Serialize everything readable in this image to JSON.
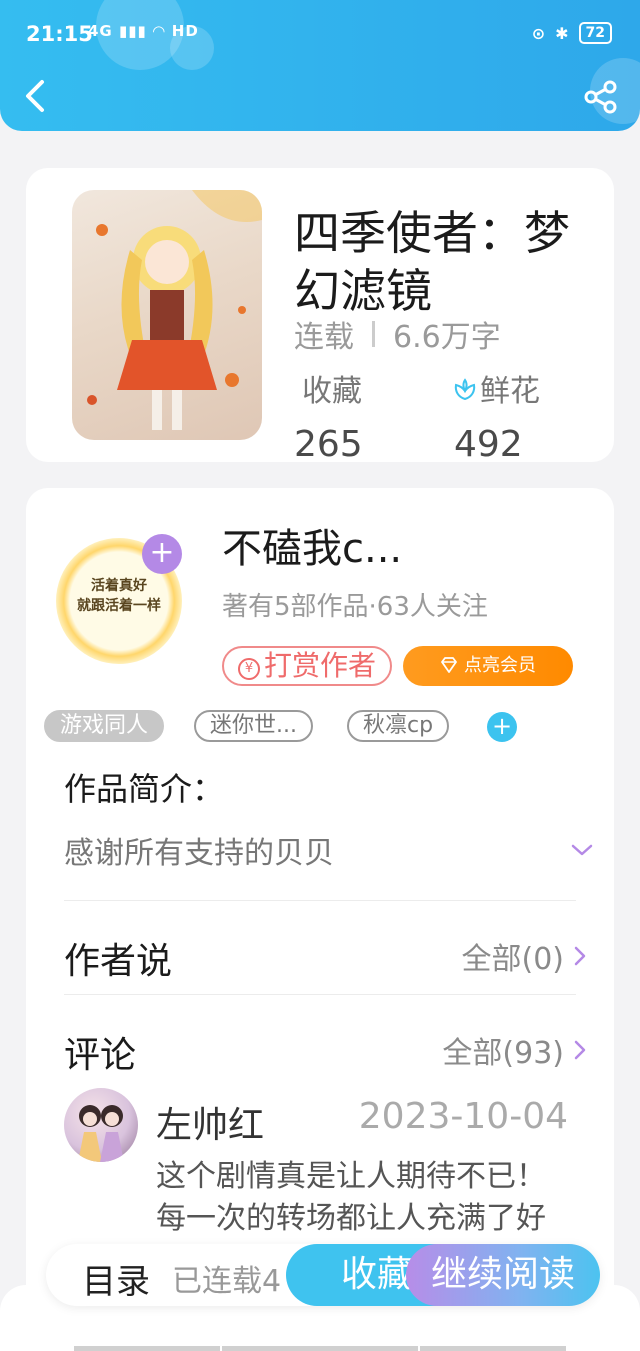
{
  "status_bar": {
    "time": "21:15",
    "network": "4G",
    "network_extra": "HD",
    "battery": "72"
  },
  "book": {
    "title": "四季使者：梦幻滤镜",
    "status": "连载",
    "word_count": "6.6万字",
    "favorites_label": "收藏",
    "favorites_value": "265",
    "flowers_label": "鲜花",
    "flowers_value": "492"
  },
  "author": {
    "name": "不磕我c...",
    "stats": "著有5部作品·63人关注",
    "avatar_text_line1": "活着真好",
    "avatar_text_line2": "就跟活着一样",
    "follow_symbol": "+",
    "tip_label": "打赏作者",
    "tip_icon_glyph": "¥",
    "vip_label": "点亮会员"
  },
  "tags": [
    "游戏同人",
    "迷你世...",
    "秋凛cp"
  ],
  "tag_add_symbol": "+",
  "intro": {
    "title": "作品简介：",
    "text": "感谢所有支持的贝贝"
  },
  "author_says": {
    "title": "作者说",
    "link": "全部(0)"
  },
  "comments": {
    "title": "评论",
    "link": "全部(93)",
    "items": [
      {
        "user": "左帅红",
        "date": "2023-10-04",
        "text": "这个剧情真是让人期待不已！每一次的转场都让人充满了好奇和紧张，离箭的词"
      }
    ]
  },
  "bottom_bar": {
    "toc_label": "目录",
    "chapter_status": "已连载4",
    "collect_label": "收藏",
    "read_label": "继续阅读"
  },
  "colors": {
    "header_blue": "#35bdf0",
    "accent_purple": "#b489e6",
    "vip_orange": "#ff8a00",
    "tip_red": "#ef6b6b"
  }
}
